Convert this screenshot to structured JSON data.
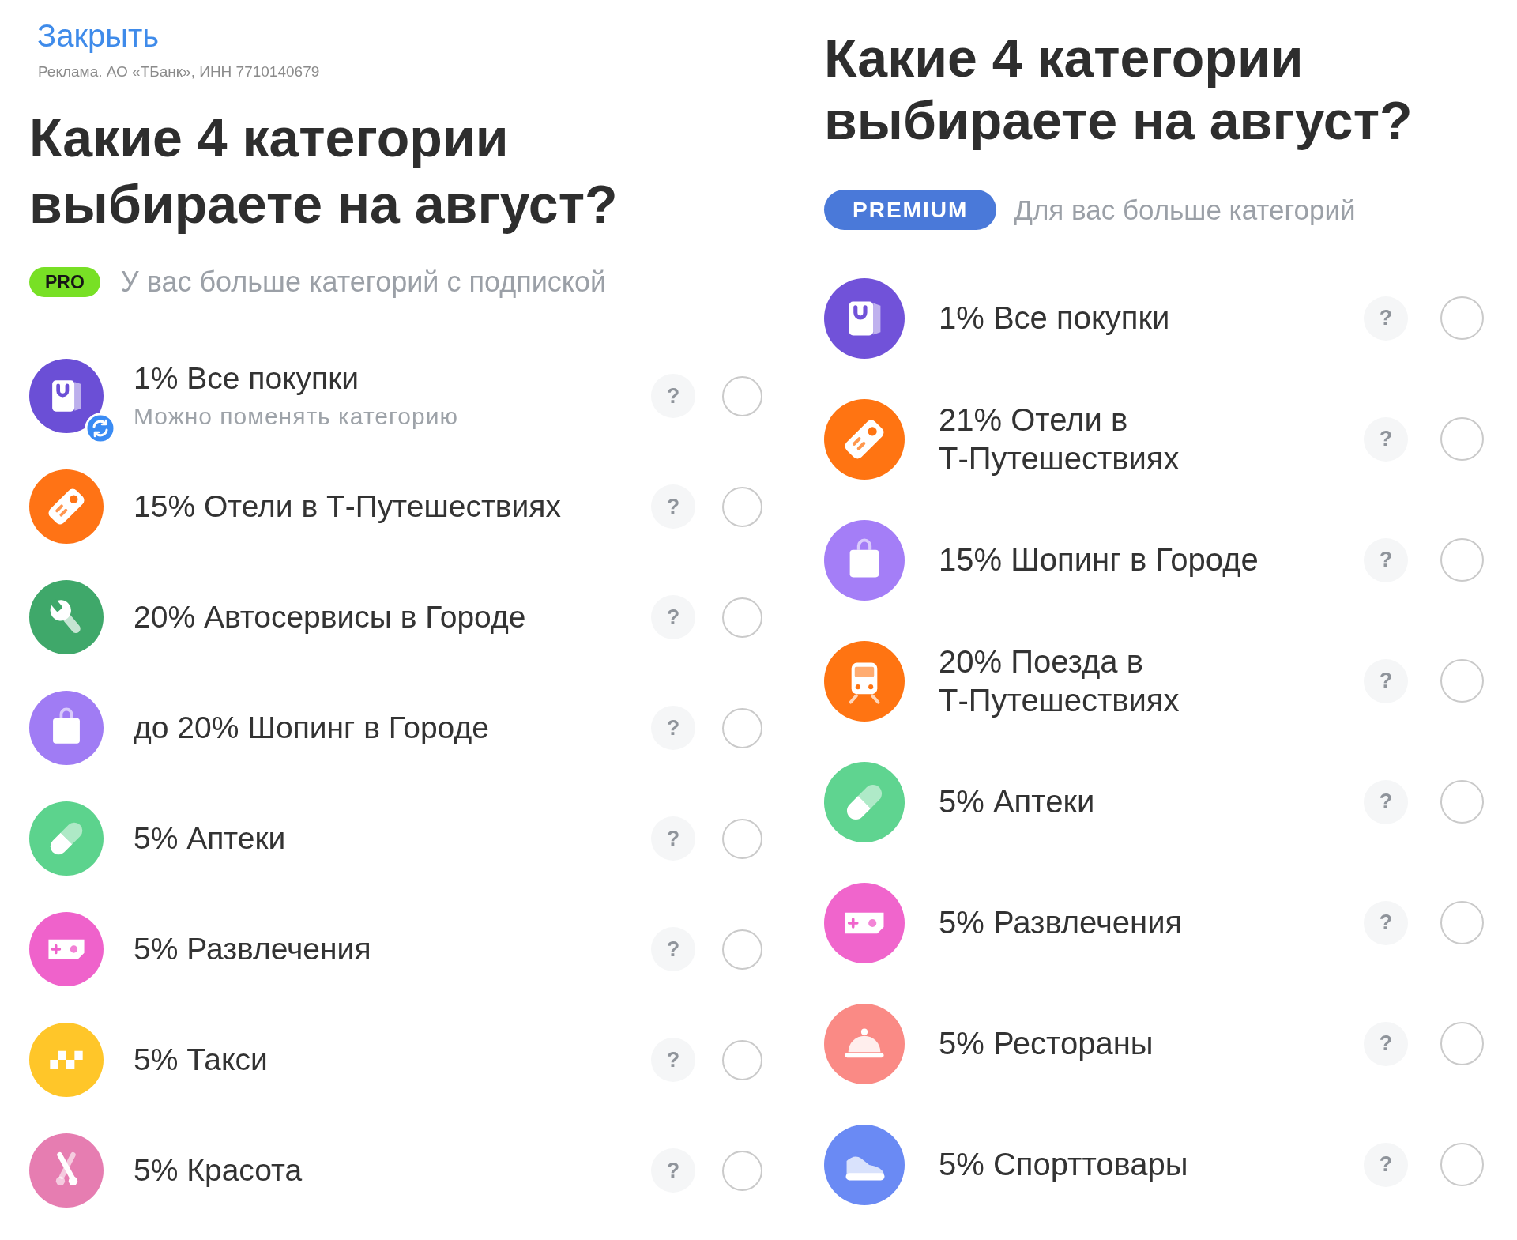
{
  "panels": [
    {
      "close_link": "Закрыть",
      "ad_notice": "Реклама. АО «ТБанк», ИНН 7710140679",
      "title": "Какие 4 категории выбираете на август?",
      "badge": {
        "kind": "pro",
        "text": "PRO"
      },
      "subtitle": "У вас больше категорий с подпиской",
      "categories": [
        {
          "kind": "purchases",
          "color": "#6b4fd6",
          "label": "1% Все покупки",
          "note": "Можно поменять категорию",
          "swappable": true,
          "help": "?",
          "selected": false
        },
        {
          "kind": "hotels",
          "color": "#ff7315",
          "label": "15% Отели в Т-Путешествиях",
          "swappable": false,
          "help": "?",
          "selected": false
        },
        {
          "kind": "autoservice",
          "color": "#3fa86a",
          "label": "20% Автосервисы в Городе",
          "swappable": false,
          "help": "?",
          "selected": false
        },
        {
          "kind": "shopping",
          "color": "#a07cf4",
          "label": "до 20% Шопинг в Городе",
          "swappable": false,
          "help": "?",
          "selected": false
        },
        {
          "kind": "pharmacy",
          "color": "#5cd38d",
          "label": "5% Аптеки",
          "swappable": false,
          "help": "?",
          "selected": false
        },
        {
          "kind": "entertainment",
          "color": "#ef62cb",
          "label": "5% Развлечения",
          "swappable": false,
          "help": "?",
          "selected": false
        },
        {
          "kind": "taxi",
          "color": "#ffc629",
          "label": "5% Такси",
          "swappable": false,
          "help": "?",
          "selected": false
        },
        {
          "kind": "beauty",
          "color": "#e67db1",
          "label": "5% Красота",
          "swappable": false,
          "help": "?",
          "selected": false
        }
      ]
    },
    {
      "title": "Какие 4 категории выбираете на август?",
      "badge": {
        "kind": "premium",
        "text": "PREMIUM"
      },
      "subtitle": "Для вас больше категорий",
      "categories": [
        {
          "kind": "purchases",
          "color": "#7152d9",
          "label": "1% Все покупки",
          "swappable": false,
          "help": "?",
          "selected": false
        },
        {
          "kind": "hotels",
          "color": "#ff7412",
          "label": "21% Отели в Т-Путешествиях",
          "swappable": false,
          "help": "?",
          "selected": false
        },
        {
          "kind": "shopping",
          "color": "#a47ef7",
          "label": "15% Шопинг в Городе",
          "swappable": false,
          "help": "?",
          "selected": false
        },
        {
          "kind": "trains",
          "color": "#ff7412",
          "label": "20% Поезда в Т-Путешествиях",
          "swappable": false,
          "help": "?",
          "selected": false
        },
        {
          "kind": "pharmacy",
          "color": "#5fd490",
          "label": "5% Аптеки",
          "swappable": false,
          "help": "?",
          "selected": false
        },
        {
          "kind": "entertainment",
          "color": "#f065cc",
          "label": "5% Развлечения",
          "swappable": false,
          "help": "?",
          "selected": false
        },
        {
          "kind": "restaurants",
          "color": "#fa8a85",
          "label": "5% Рестораны",
          "swappable": false,
          "help": "?",
          "selected": false
        },
        {
          "kind": "sport",
          "color": "#6a8af4",
          "label": "5% Спорттовары",
          "swappable": false,
          "help": "?",
          "selected": false
        }
      ]
    }
  ]
}
